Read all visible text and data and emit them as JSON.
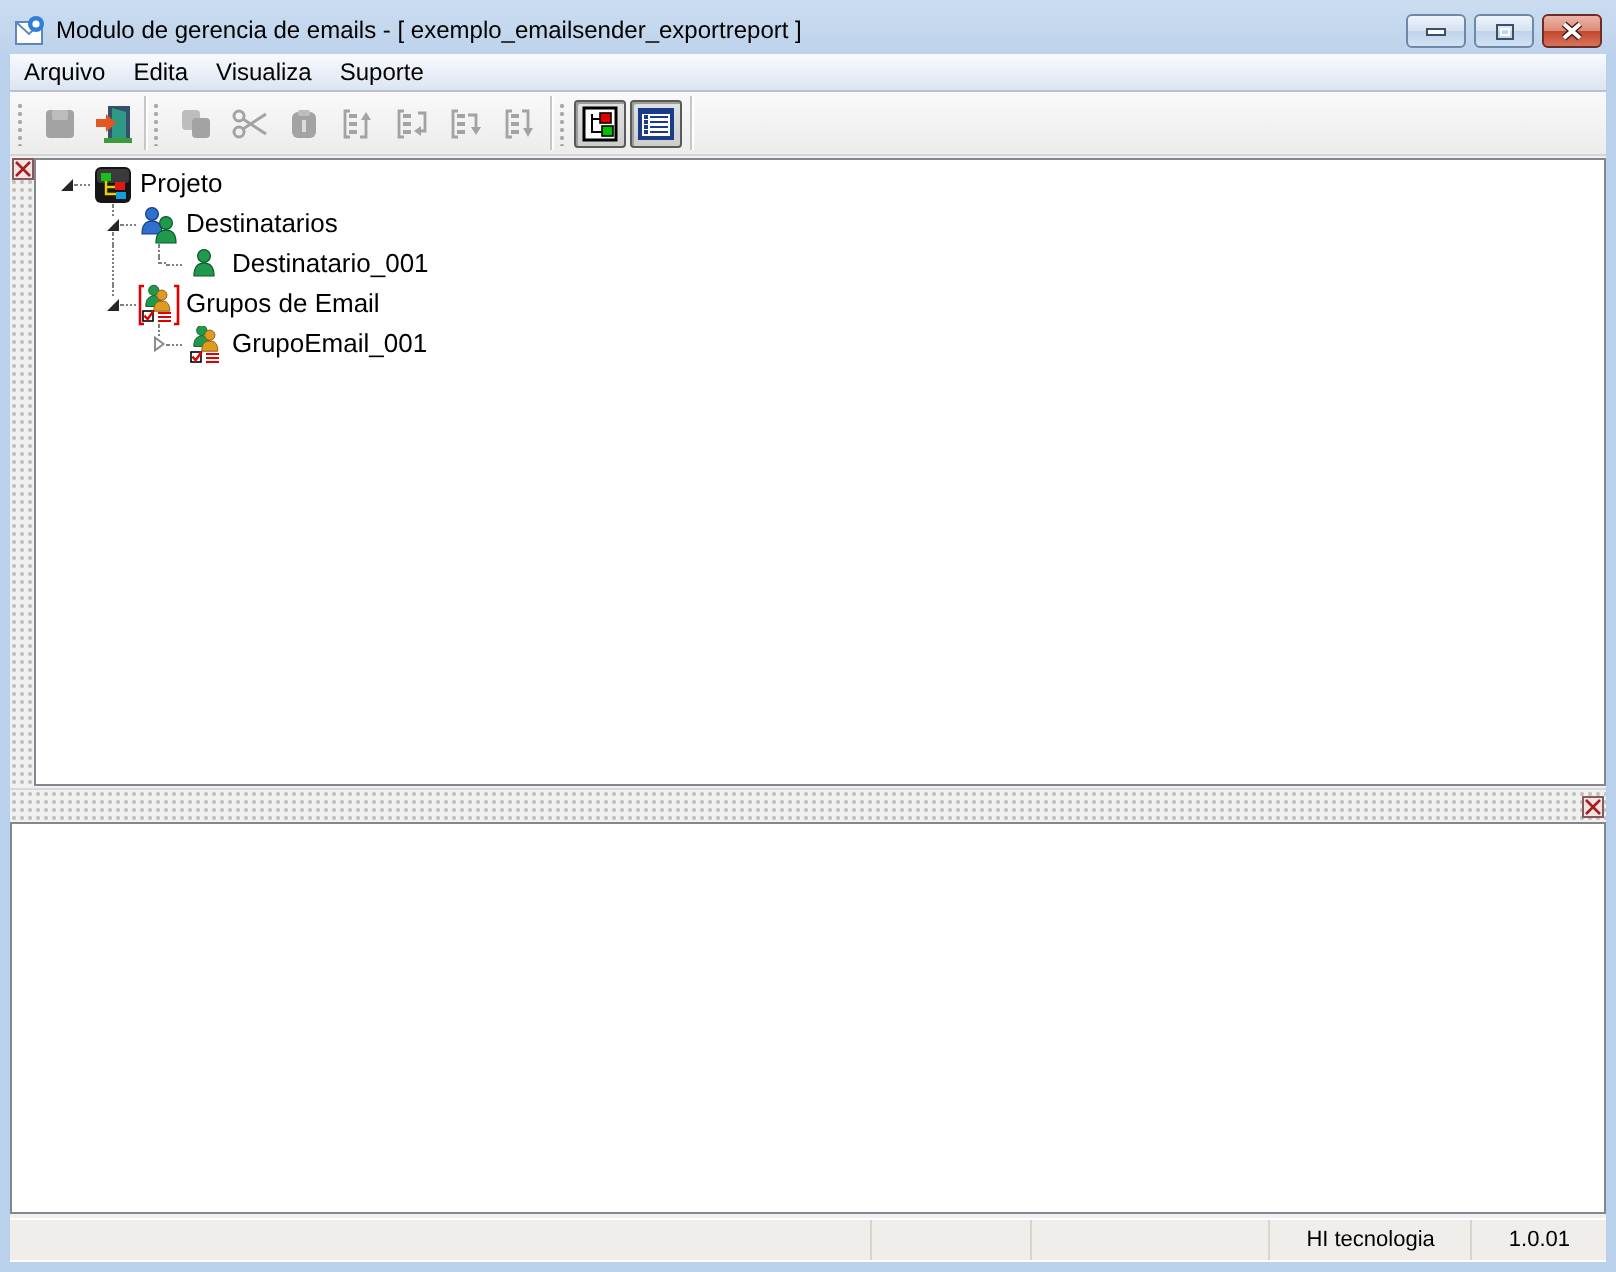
{
  "window": {
    "title": "Modulo de gerencia de emails - [ exemplo_emailsender_exportreport ]"
  },
  "menu": [
    "Arquivo",
    "Edita",
    "Visualiza",
    "Suporte"
  ],
  "toolbar": [
    {
      "items": [
        {
          "kind": "save",
          "disabled": true,
          "pressed": false
        },
        {
          "kind": "exit",
          "disabled": false,
          "pressed": false
        }
      ]
    },
    {
      "items": [
        {
          "kind": "copy",
          "disabled": true,
          "pressed": false
        },
        {
          "kind": "cut",
          "disabled": true,
          "pressed": false
        },
        {
          "kind": "paste",
          "disabled": true,
          "pressed": false
        },
        {
          "kind": "list_up",
          "disabled": true,
          "pressed": false
        },
        {
          "kind": "list_left",
          "disabled": true,
          "pressed": false
        },
        {
          "kind": "list_right",
          "disabled": true,
          "pressed": false
        },
        {
          "kind": "list_down",
          "disabled": true,
          "pressed": false
        }
      ]
    },
    {
      "items": [
        {
          "kind": "tree_view",
          "disabled": false,
          "pressed": true
        },
        {
          "kind": "list_view",
          "disabled": false,
          "pressed": true
        }
      ]
    }
  ],
  "tree": [
    {
      "label": "Projeto",
      "kind": "project",
      "expanded": true,
      "children": [
        {
          "label": "Destinatarios",
          "kind": "recipients",
          "expanded": true,
          "children": [
            {
              "label": "Destinatario_001",
              "kind": "recipient"
            }
          ]
        },
        {
          "label": "Grupos de Email",
          "kind": "groups",
          "expanded": true,
          "children": [
            {
              "label": "GrupoEmail_001",
              "kind": "group",
              "expanded": false
            }
          ]
        }
      ]
    }
  ],
  "status_bar": {
    "panels": [
      "HI tecnologia",
      "1.0.01"
    ]
  }
}
